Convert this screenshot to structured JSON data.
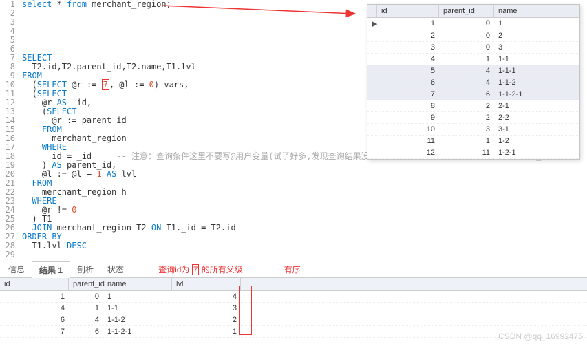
{
  "code_lines": [
    {
      "n": 1,
      "frag": [
        {
          "t": "select",
          "c": "kw"
        },
        {
          "t": " * "
        },
        {
          "t": "from",
          "c": "kw"
        },
        {
          "t": " merchant_region;",
          "c": "ident"
        }
      ]
    },
    {
      "n": 2,
      "frag": []
    },
    {
      "n": 3,
      "frag": []
    },
    {
      "n": 4,
      "frag": []
    },
    {
      "n": 5,
      "frag": []
    },
    {
      "n": 6,
      "frag": []
    },
    {
      "n": 7,
      "frag": [
        {
          "t": "SELECT",
          "c": "kw"
        }
      ]
    },
    {
      "n": 8,
      "frag": [
        {
          "t": "  T2.id,T2.parent_id,T2.name,T1.lvl"
        }
      ]
    },
    {
      "n": 9,
      "frag": [
        {
          "t": "FROM",
          "c": "kw"
        }
      ]
    },
    {
      "n": 10,
      "frag": [
        {
          "t": "  ("
        },
        {
          "t": "SELECT",
          "c": "kw"
        },
        {
          "t": " @r := "
        },
        {
          "t": "7",
          "c": "num",
          "box": true
        },
        {
          "t": ", @l := "
        },
        {
          "t": "0",
          "c": "num"
        },
        {
          "t": ") vars,"
        }
      ]
    },
    {
      "n": 11,
      "frag": [
        {
          "t": "  ("
        },
        {
          "t": "SELECT",
          "c": "kw"
        }
      ]
    },
    {
      "n": 12,
      "frag": [
        {
          "t": "    @r "
        },
        {
          "t": "AS",
          "c": "kw"
        },
        {
          "t": " _id,"
        }
      ]
    },
    {
      "n": 13,
      "frag": [
        {
          "t": "    ("
        },
        {
          "t": "SELECT",
          "c": "kw"
        }
      ]
    },
    {
      "n": 14,
      "frag": [
        {
          "t": "      @r := parent_id"
        }
      ]
    },
    {
      "n": 15,
      "frag": [
        {
          "t": "    "
        },
        {
          "t": "FROM",
          "c": "kw"
        }
      ]
    },
    {
      "n": 16,
      "frag": [
        {
          "t": "      merchant_region"
        }
      ]
    },
    {
      "n": 17,
      "frag": [
        {
          "t": "    "
        },
        {
          "t": "WHERE",
          "c": "kw"
        }
      ]
    },
    {
      "n": 18,
      "frag": [
        {
          "t": "      id = _id     "
        },
        {
          "t": "-- 注意：查询条件这里不要写@用户变量(试了好多,发现查询结果没什么固定的规律,这也可能是前面要写@r as _id的原因)",
          "c": "comment"
        }
      ]
    },
    {
      "n": 19,
      "frag": [
        {
          "t": "    ) "
        },
        {
          "t": "AS",
          "c": "kw"
        },
        {
          "t": " parent_id,"
        }
      ]
    },
    {
      "n": 20,
      "frag": [
        {
          "t": "    @l := @l + "
        },
        {
          "t": "1",
          "c": "num"
        },
        {
          "t": " "
        },
        {
          "t": "AS",
          "c": "kw"
        },
        {
          "t": " lvl"
        }
      ]
    },
    {
      "n": 21,
      "frag": [
        {
          "t": "  "
        },
        {
          "t": "FROM",
          "c": "kw"
        }
      ]
    },
    {
      "n": 22,
      "frag": [
        {
          "t": "    merchant_region h"
        }
      ]
    },
    {
      "n": 23,
      "frag": [
        {
          "t": "  "
        },
        {
          "t": "WHERE",
          "c": "kw"
        }
      ]
    },
    {
      "n": 24,
      "frag": [
        {
          "t": "    @r != "
        },
        {
          "t": "0",
          "c": "num"
        }
      ]
    },
    {
      "n": 25,
      "frag": [
        {
          "t": "  ) T1"
        }
      ]
    },
    {
      "n": 26,
      "frag": [
        {
          "t": "  "
        },
        {
          "t": "JOIN",
          "c": "kw"
        },
        {
          "t": " merchant_region T2 "
        },
        {
          "t": "ON",
          "c": "kw"
        },
        {
          "t": " T1._id = T2.id"
        }
      ]
    },
    {
      "n": 27,
      "frag": [
        {
          "t": "ORDER BY",
          "c": "kw"
        }
      ]
    },
    {
      "n": 28,
      "frag": [
        {
          "t": "  T1.lvl "
        },
        {
          "t": "DESC",
          "c": "kw"
        }
      ]
    },
    {
      "n": 29,
      "frag": []
    }
  ],
  "popup": {
    "headers": {
      "col_mark": "",
      "id": "id",
      "pid": "parent_id",
      "name": "name"
    },
    "row_marker": "▶",
    "rows": [
      {
        "id": "1",
        "pid": "0",
        "name": "1"
      },
      {
        "id": "2",
        "pid": "0",
        "name": "2"
      },
      {
        "id": "3",
        "pid": "0",
        "name": "3"
      },
      {
        "id": "4",
        "pid": "1",
        "name": "1-1"
      },
      {
        "id": "5",
        "pid": "4",
        "name": "1-1-1"
      },
      {
        "id": "6",
        "pid": "4",
        "name": "1-1-2"
      },
      {
        "id": "7",
        "pid": "6",
        "name": "1-1-2-1"
      },
      {
        "id": "8",
        "pid": "2",
        "name": "2-1"
      },
      {
        "id": "9",
        "pid": "2",
        "name": "2-2"
      },
      {
        "id": "10",
        "pid": "3",
        "name": "3-1"
      },
      {
        "id": "11",
        "pid": "1",
        "name": "1-2"
      },
      {
        "id": "12",
        "pid": "11",
        "name": "1-2-1"
      }
    ]
  },
  "tabs": {
    "info": "信息",
    "result": "结果 1",
    "analyze": "剖析",
    "status": "状态"
  },
  "annotation": {
    "pre": "查询id为",
    "val": "7",
    "post": "的所有父级",
    "ordered": "有序"
  },
  "result": {
    "headers": {
      "id": "id",
      "pid": "parent_id",
      "name": "name",
      "lvl": "lvl"
    },
    "rows": [
      {
        "id": "1",
        "pid": "0",
        "name": "1",
        "lvl": "4"
      },
      {
        "id": "4",
        "pid": "1",
        "name": "1-1",
        "lvl": "3"
      },
      {
        "id": "6",
        "pid": "4",
        "name": "1-1-2",
        "lvl": "2"
      },
      {
        "id": "7",
        "pid": "6",
        "name": "1-1-2-1",
        "lvl": "1"
      }
    ]
  },
  "watermark": "CSDN @qq_16992475"
}
